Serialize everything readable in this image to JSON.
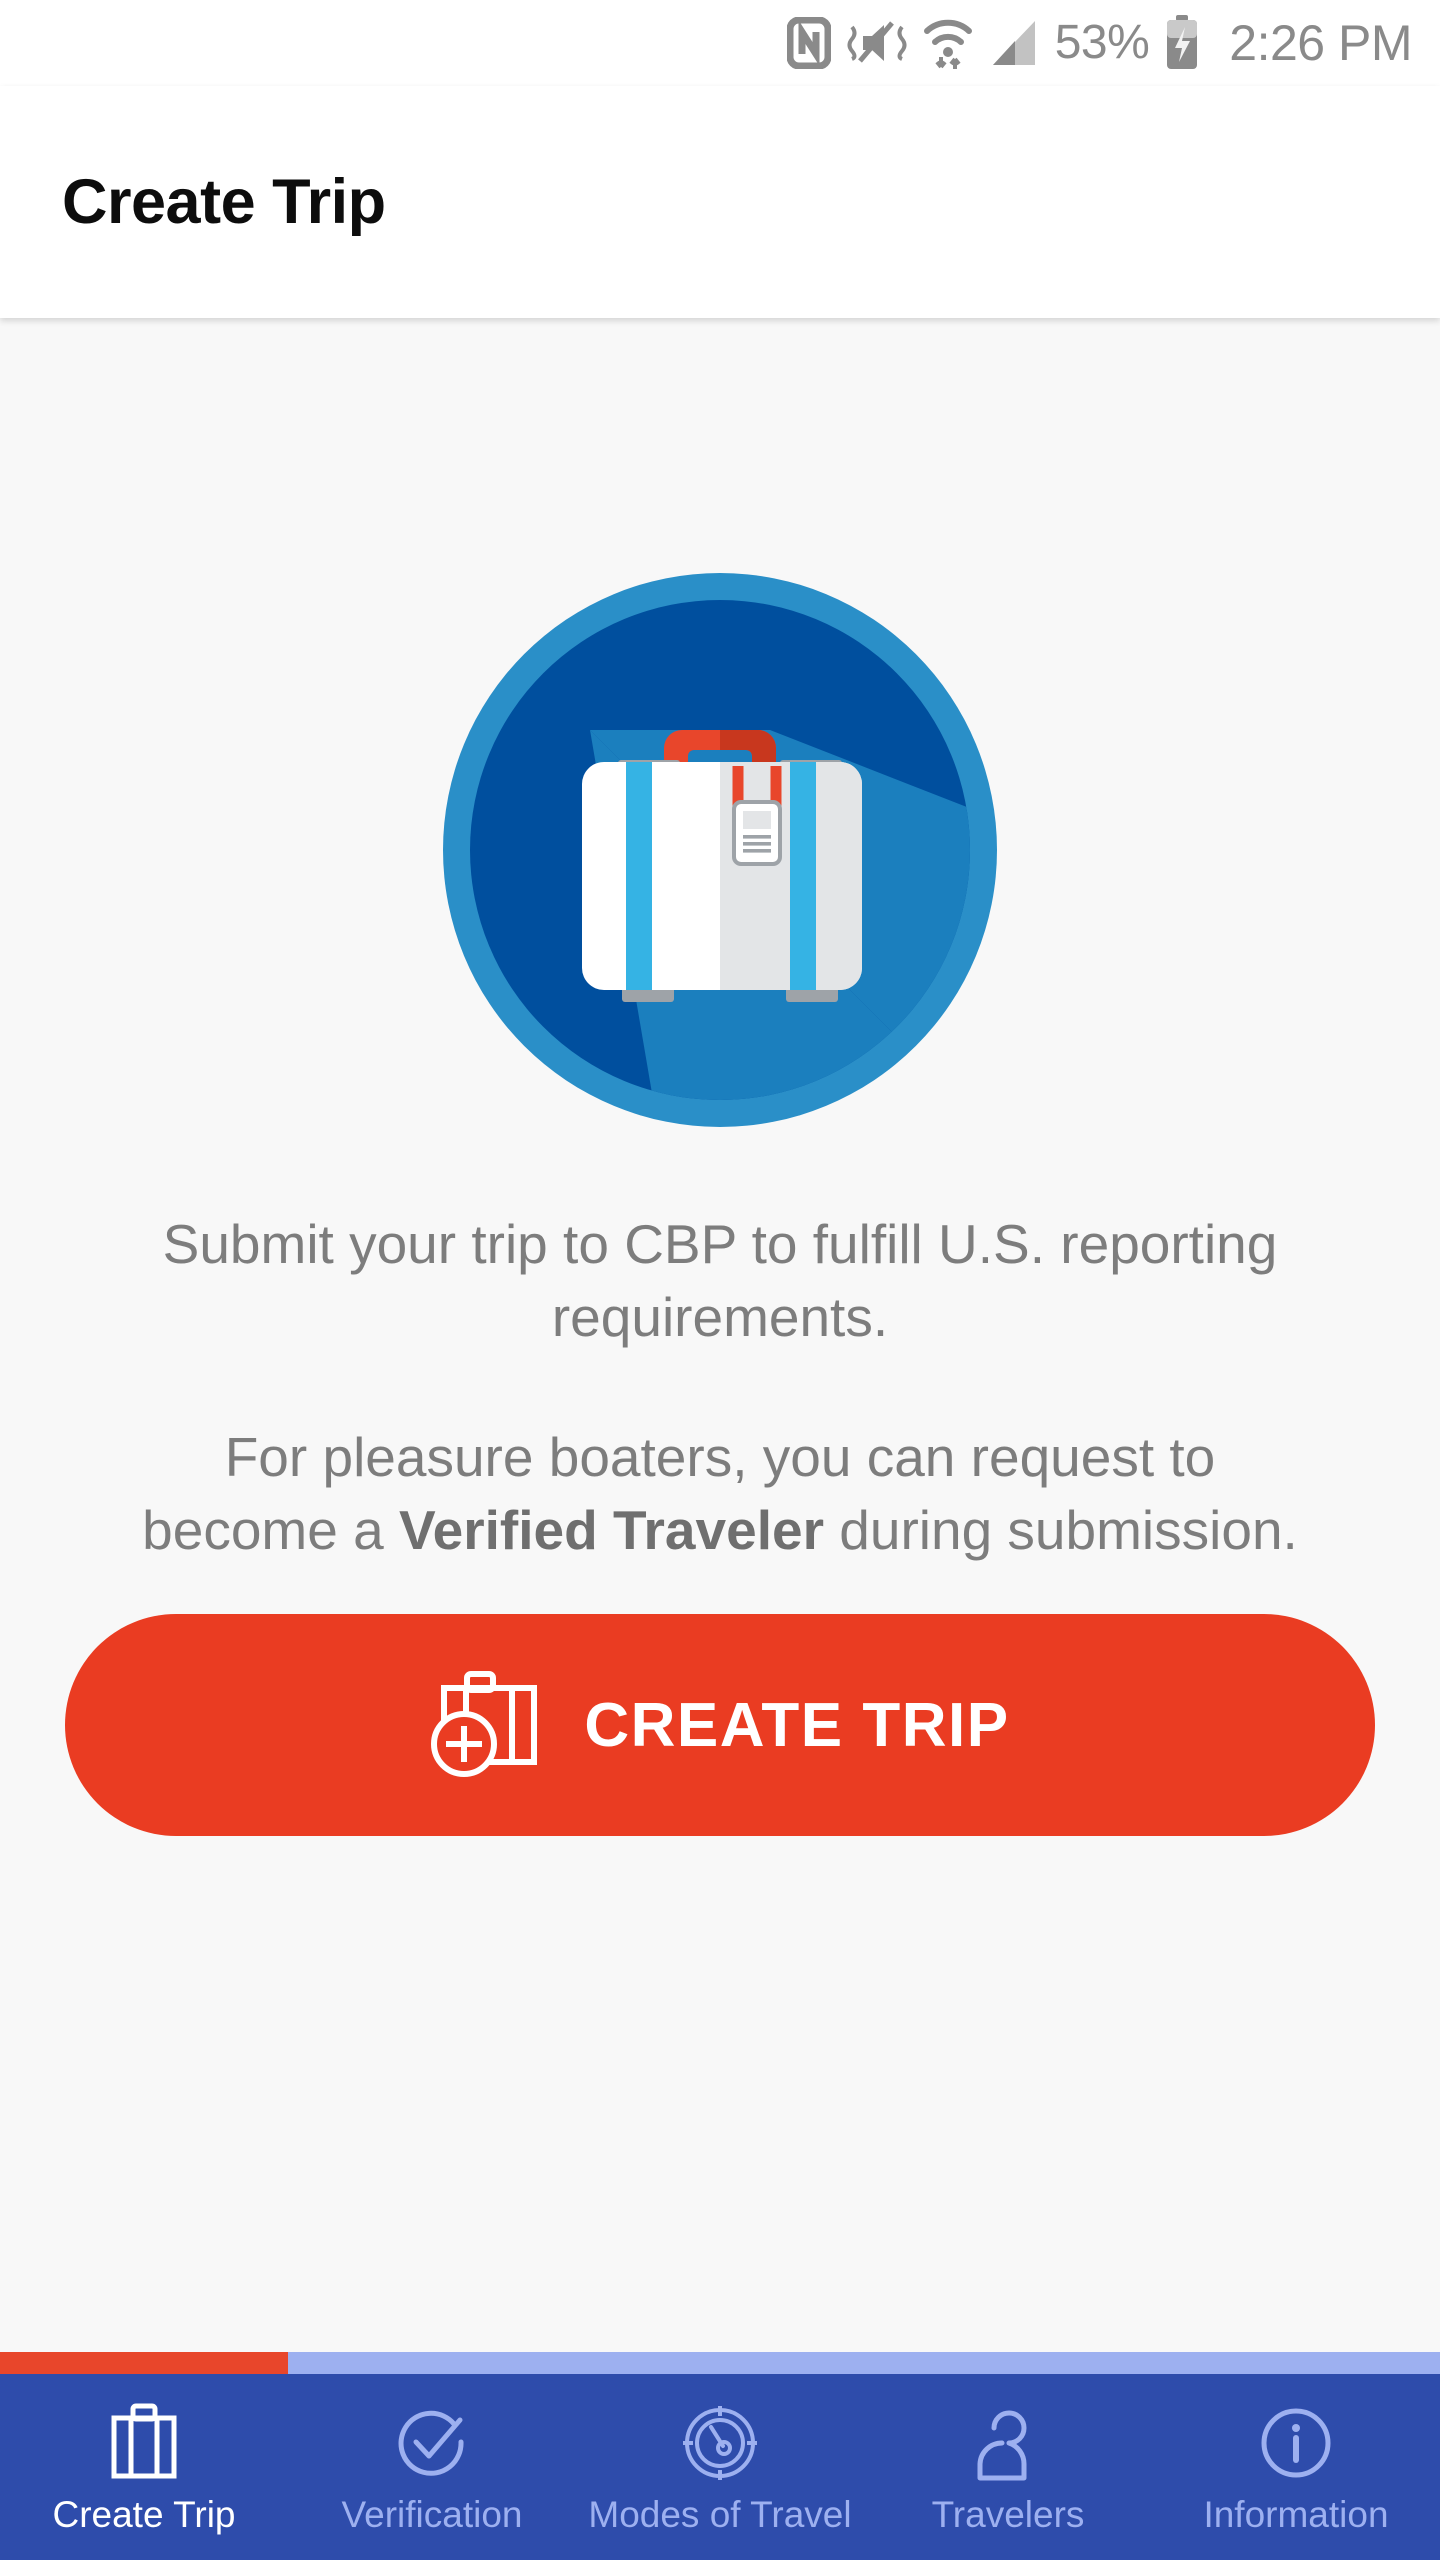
{
  "status_bar": {
    "nfc_icon": "nfc-icon",
    "sound_off_icon": "vibrate-mute-icon",
    "wifi_icon": "wifi-data-transfer-icon",
    "signal_icon": "cellular-signal-icon",
    "battery_percent": "53%",
    "battery_icon": "battery-charging-icon",
    "time": "2:26 PM",
    "text_color": "#8a8a8a"
  },
  "header": {
    "title": "Create Trip"
  },
  "hero": {
    "icon_name": "suitcase-badge-illustration",
    "ring_color": "#2a8fc8",
    "disc_color": "#004f9e",
    "shadow_color": "#1b7fbe",
    "case_color": "#ffffff",
    "case_shade_color": "#e3e5e7",
    "stripe_color": "#35b3e4",
    "handle_color": "#e8462b",
    "handle_shade_color": "#c8371e",
    "foot_color": "#9ea3a8",
    "tag_color": "#ffffff"
  },
  "body": {
    "paragraph_1": "Submit your trip to CBP to fulfill U.S. reporting requirements.",
    "paragraph_2_part_1": "For pleasure boaters, you can request to become a ",
    "paragraph_2_bold": "Verified Traveler",
    "paragraph_2_part_2": " during submission.",
    "text_color": "#7d7d7d"
  },
  "cta": {
    "label": "CREATE TRIP",
    "icon_name": "add-suitcase-icon",
    "background_color": "#ea3c22",
    "text_color": "#ffffff"
  },
  "tab_indicator": {
    "active_color": "#e8462b",
    "inactive_color": "#9db0f0",
    "active_fraction": "20%"
  },
  "bottom_nav": {
    "background_color": "#2e4cab",
    "active_color": "#ffffff",
    "inactive_color": "#9db0f0",
    "items": [
      {
        "label": "Create Trip",
        "icon": "suitcase-icon",
        "active": true
      },
      {
        "label": "Verification",
        "icon": "check-circle-icon",
        "active": false
      },
      {
        "label": "Modes of Travel",
        "icon": "compass-icon",
        "active": false
      },
      {
        "label": "Travelers",
        "icon": "person-icon",
        "active": false
      },
      {
        "label": "Information",
        "icon": "info-circle-icon",
        "active": false
      }
    ]
  }
}
